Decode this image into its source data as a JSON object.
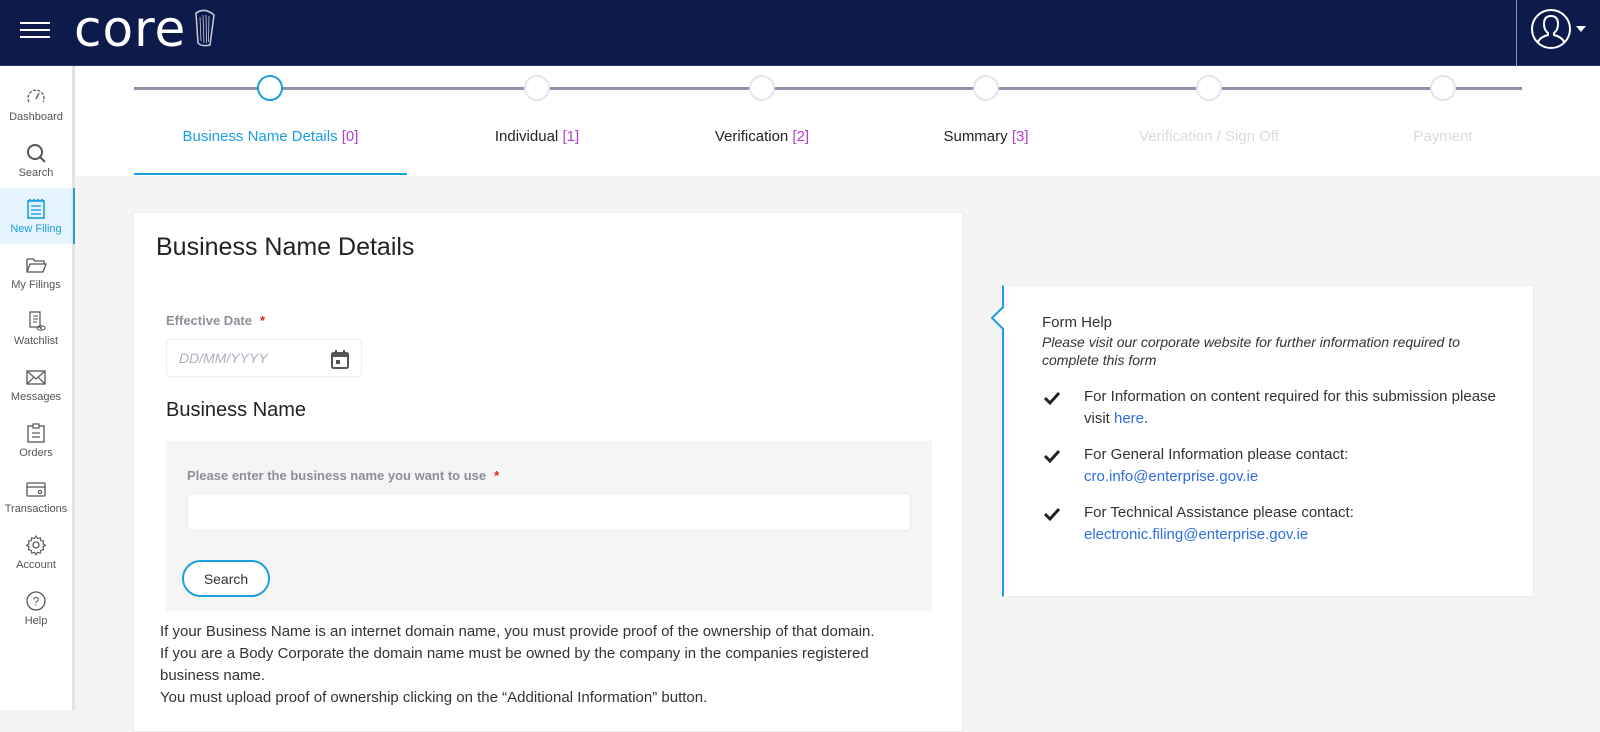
{
  "header": {
    "logo_text": "core",
    "logo_icon": "harp-icon",
    "menu_icon": "hamburger-icon",
    "user_icon": "user-avatar-icon"
  },
  "sidebar": {
    "items": [
      {
        "label": "Dashboard",
        "icon": "speedometer-icon",
        "active": false
      },
      {
        "label": "Search",
        "icon": "search-icon",
        "active": false
      },
      {
        "label": "New Filing",
        "icon": "notepad-icon",
        "active": true
      },
      {
        "label": "My Filings",
        "icon": "folder-icon",
        "active": false
      },
      {
        "label": "Watchlist",
        "icon": "watchlist-icon",
        "active": false
      },
      {
        "label": "Messages",
        "icon": "envelope-icon",
        "active": false
      },
      {
        "label": "Orders",
        "icon": "clipboard-icon",
        "active": false
      },
      {
        "label": "Transactions",
        "icon": "wallet-icon",
        "active": false
      },
      {
        "label": "Account",
        "icon": "gear-icon",
        "active": false
      },
      {
        "label": "Help",
        "icon": "help-icon",
        "active": false
      }
    ]
  },
  "stepper": {
    "steps": [
      {
        "label": "Business Name Details",
        "num": "[0]",
        "state": "active"
      },
      {
        "label": "Individual",
        "num": "[1]",
        "state": "enabled"
      },
      {
        "label": "Verification",
        "num": "[2]",
        "state": "enabled"
      },
      {
        "label": "Summary",
        "num": "[3]",
        "state": "enabled"
      },
      {
        "label": "Verification / Sign Off",
        "num": "",
        "state": "disabled"
      },
      {
        "label": "Payment",
        "num": "",
        "state": "disabled"
      }
    ]
  },
  "form": {
    "title": "Business Name Details",
    "effective_date_label": "Effective Date",
    "required_mark": "*",
    "date_placeholder": "DD/MM/YYYY",
    "date_value": "",
    "business_name_section": "Business Name",
    "business_name_label": "Please enter the business name you want to use",
    "business_name_value": "",
    "search_button": "Search",
    "info_lines": [
      "If your Business Name is an internet domain name, you must provide proof of the ownership of that domain.",
      "If you are a Body Corporate the domain name must be owned by the company in the companies registered business name.",
      "You must upload proof of ownership clicking on the “Additional Information” button."
    ]
  },
  "help": {
    "title": "Form Help",
    "subtitle": "Please visit our corporate website for further information required to complete this form",
    "items": [
      {
        "text": "For Information on content required for this submission please visit ",
        "link": "here",
        "suffix": "."
      },
      {
        "text": "For General Information please contact: ",
        "link": "cro.info@enterprise.gov.ie",
        "suffix": ""
      },
      {
        "text": "For Technical Assistance please contact: ",
        "link": "electronic.filing@enterprise.gov.ie",
        "suffix": ""
      }
    ]
  },
  "colors": {
    "header_bg": "#0c1b4b",
    "accent": "#1a9fe0",
    "step_number": "#b23ed1",
    "link": "#2f6ee0",
    "required": "#e02020"
  }
}
